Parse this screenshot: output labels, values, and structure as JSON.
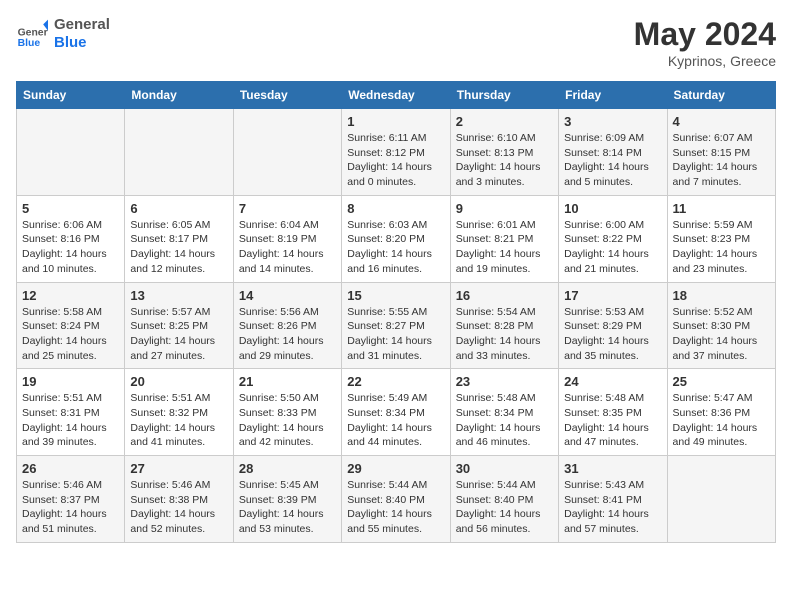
{
  "logo": {
    "text_general": "General",
    "text_blue": "Blue"
  },
  "title": "May 2024",
  "subtitle": "Kyprinos, Greece",
  "days_of_week": [
    "Sunday",
    "Monday",
    "Tuesday",
    "Wednesday",
    "Thursday",
    "Friday",
    "Saturday"
  ],
  "weeks": [
    [
      {
        "day": "",
        "info": ""
      },
      {
        "day": "",
        "info": ""
      },
      {
        "day": "",
        "info": ""
      },
      {
        "day": "1",
        "info": "Sunrise: 6:11 AM\nSunset: 8:12 PM\nDaylight: 14 hours\nand 0 minutes."
      },
      {
        "day": "2",
        "info": "Sunrise: 6:10 AM\nSunset: 8:13 PM\nDaylight: 14 hours\nand 3 minutes."
      },
      {
        "day": "3",
        "info": "Sunrise: 6:09 AM\nSunset: 8:14 PM\nDaylight: 14 hours\nand 5 minutes."
      },
      {
        "day": "4",
        "info": "Sunrise: 6:07 AM\nSunset: 8:15 PM\nDaylight: 14 hours\nand 7 minutes."
      }
    ],
    [
      {
        "day": "5",
        "info": "Sunrise: 6:06 AM\nSunset: 8:16 PM\nDaylight: 14 hours\nand 10 minutes."
      },
      {
        "day": "6",
        "info": "Sunrise: 6:05 AM\nSunset: 8:17 PM\nDaylight: 14 hours\nand 12 minutes."
      },
      {
        "day": "7",
        "info": "Sunrise: 6:04 AM\nSunset: 8:19 PM\nDaylight: 14 hours\nand 14 minutes."
      },
      {
        "day": "8",
        "info": "Sunrise: 6:03 AM\nSunset: 8:20 PM\nDaylight: 14 hours\nand 16 minutes."
      },
      {
        "day": "9",
        "info": "Sunrise: 6:01 AM\nSunset: 8:21 PM\nDaylight: 14 hours\nand 19 minutes."
      },
      {
        "day": "10",
        "info": "Sunrise: 6:00 AM\nSunset: 8:22 PM\nDaylight: 14 hours\nand 21 minutes."
      },
      {
        "day": "11",
        "info": "Sunrise: 5:59 AM\nSunset: 8:23 PM\nDaylight: 14 hours\nand 23 minutes."
      }
    ],
    [
      {
        "day": "12",
        "info": "Sunrise: 5:58 AM\nSunset: 8:24 PM\nDaylight: 14 hours\nand 25 minutes."
      },
      {
        "day": "13",
        "info": "Sunrise: 5:57 AM\nSunset: 8:25 PM\nDaylight: 14 hours\nand 27 minutes."
      },
      {
        "day": "14",
        "info": "Sunrise: 5:56 AM\nSunset: 8:26 PM\nDaylight: 14 hours\nand 29 minutes."
      },
      {
        "day": "15",
        "info": "Sunrise: 5:55 AM\nSunset: 8:27 PM\nDaylight: 14 hours\nand 31 minutes."
      },
      {
        "day": "16",
        "info": "Sunrise: 5:54 AM\nSunset: 8:28 PM\nDaylight: 14 hours\nand 33 minutes."
      },
      {
        "day": "17",
        "info": "Sunrise: 5:53 AM\nSunset: 8:29 PM\nDaylight: 14 hours\nand 35 minutes."
      },
      {
        "day": "18",
        "info": "Sunrise: 5:52 AM\nSunset: 8:30 PM\nDaylight: 14 hours\nand 37 minutes."
      }
    ],
    [
      {
        "day": "19",
        "info": "Sunrise: 5:51 AM\nSunset: 8:31 PM\nDaylight: 14 hours\nand 39 minutes."
      },
      {
        "day": "20",
        "info": "Sunrise: 5:51 AM\nSunset: 8:32 PM\nDaylight: 14 hours\nand 41 minutes."
      },
      {
        "day": "21",
        "info": "Sunrise: 5:50 AM\nSunset: 8:33 PM\nDaylight: 14 hours\nand 42 minutes."
      },
      {
        "day": "22",
        "info": "Sunrise: 5:49 AM\nSunset: 8:34 PM\nDaylight: 14 hours\nand 44 minutes."
      },
      {
        "day": "23",
        "info": "Sunrise: 5:48 AM\nSunset: 8:34 PM\nDaylight: 14 hours\nand 46 minutes."
      },
      {
        "day": "24",
        "info": "Sunrise: 5:48 AM\nSunset: 8:35 PM\nDaylight: 14 hours\nand 47 minutes."
      },
      {
        "day": "25",
        "info": "Sunrise: 5:47 AM\nSunset: 8:36 PM\nDaylight: 14 hours\nand 49 minutes."
      }
    ],
    [
      {
        "day": "26",
        "info": "Sunrise: 5:46 AM\nSunset: 8:37 PM\nDaylight: 14 hours\nand 51 minutes."
      },
      {
        "day": "27",
        "info": "Sunrise: 5:46 AM\nSunset: 8:38 PM\nDaylight: 14 hours\nand 52 minutes."
      },
      {
        "day": "28",
        "info": "Sunrise: 5:45 AM\nSunset: 8:39 PM\nDaylight: 14 hours\nand 53 minutes."
      },
      {
        "day": "29",
        "info": "Sunrise: 5:44 AM\nSunset: 8:40 PM\nDaylight: 14 hours\nand 55 minutes."
      },
      {
        "day": "30",
        "info": "Sunrise: 5:44 AM\nSunset: 8:40 PM\nDaylight: 14 hours\nand 56 minutes."
      },
      {
        "day": "31",
        "info": "Sunrise: 5:43 AM\nSunset: 8:41 PM\nDaylight: 14 hours\nand 57 minutes."
      },
      {
        "day": "",
        "info": ""
      }
    ]
  ]
}
